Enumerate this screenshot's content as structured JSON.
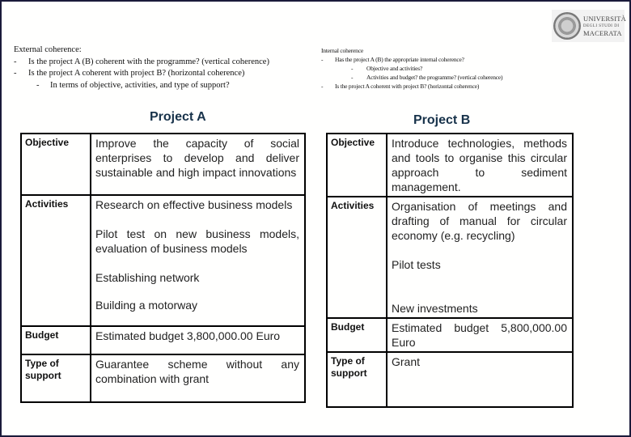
{
  "external_coherence": {
    "heading": "External coherence:",
    "items": [
      {
        "level": 1,
        "text": "Is the project A (B) coherent with the programme? (vertical coherence)"
      },
      {
        "level": 1,
        "text": "Is the project A coherent with project B? (horizontal coherence)"
      },
      {
        "level": 2,
        "text": "In terms of objective, activities, and type of support?"
      }
    ],
    "bullet": "-"
  },
  "internal_coherence": {
    "heading": "Internal coherence",
    "items": [
      {
        "level": 1,
        "text": "Has the project A (B) the appropriate internal coherence?"
      },
      {
        "level": 2,
        "text": "Objective and activities?"
      },
      {
        "level": 2,
        "text": "Activities and budget? the programme? (vertical coherence)"
      },
      {
        "level": 1,
        "text": "Is the project A coherent with project B? (horizontal coherence)"
      }
    ],
    "bullet": "-"
  },
  "logo": {
    "line1": "UNIVERSITÀ",
    "line2": "DEGLI STUDI DI",
    "line3": "MACERATA"
  },
  "project_a": {
    "title": "Project A",
    "rows": [
      {
        "label": "Objective",
        "paragraphs": [
          "Improve the capacity of social enterprises to develop and deliver sustainable and high impact innovations"
        ]
      },
      {
        "label": "Activities",
        "paragraphs": [
          "Research on effective business models",
          "Pilot test on new business models, evaluation of business models",
          "Establishing network",
          "Building a motorway"
        ]
      },
      {
        "label": "Budget",
        "paragraphs": [
          "Estimated budget 3,800,000.00 Euro"
        ]
      },
      {
        "label": "Type of support",
        "paragraphs": [
          "Guarantee scheme without any combination with grant"
        ]
      }
    ]
  },
  "project_b": {
    "title": "Project B",
    "rows": [
      {
        "label": "Objective",
        "paragraphs": [
          "Introduce technologies, methods and tools to organise this circular approach to sediment management."
        ]
      },
      {
        "label": "Activities",
        "paragraphs": [
          "Organisation of meetings and drafting of manual for circular economy (e.g. recycling)",
          "Pilot tests",
          "New investments"
        ]
      },
      {
        "label": "Budget",
        "paragraphs": [
          "Estimated budget 5,800,000.00 Euro"
        ]
      },
      {
        "label": "Type of support",
        "paragraphs": [
          "Grant"
        ]
      }
    ]
  }
}
